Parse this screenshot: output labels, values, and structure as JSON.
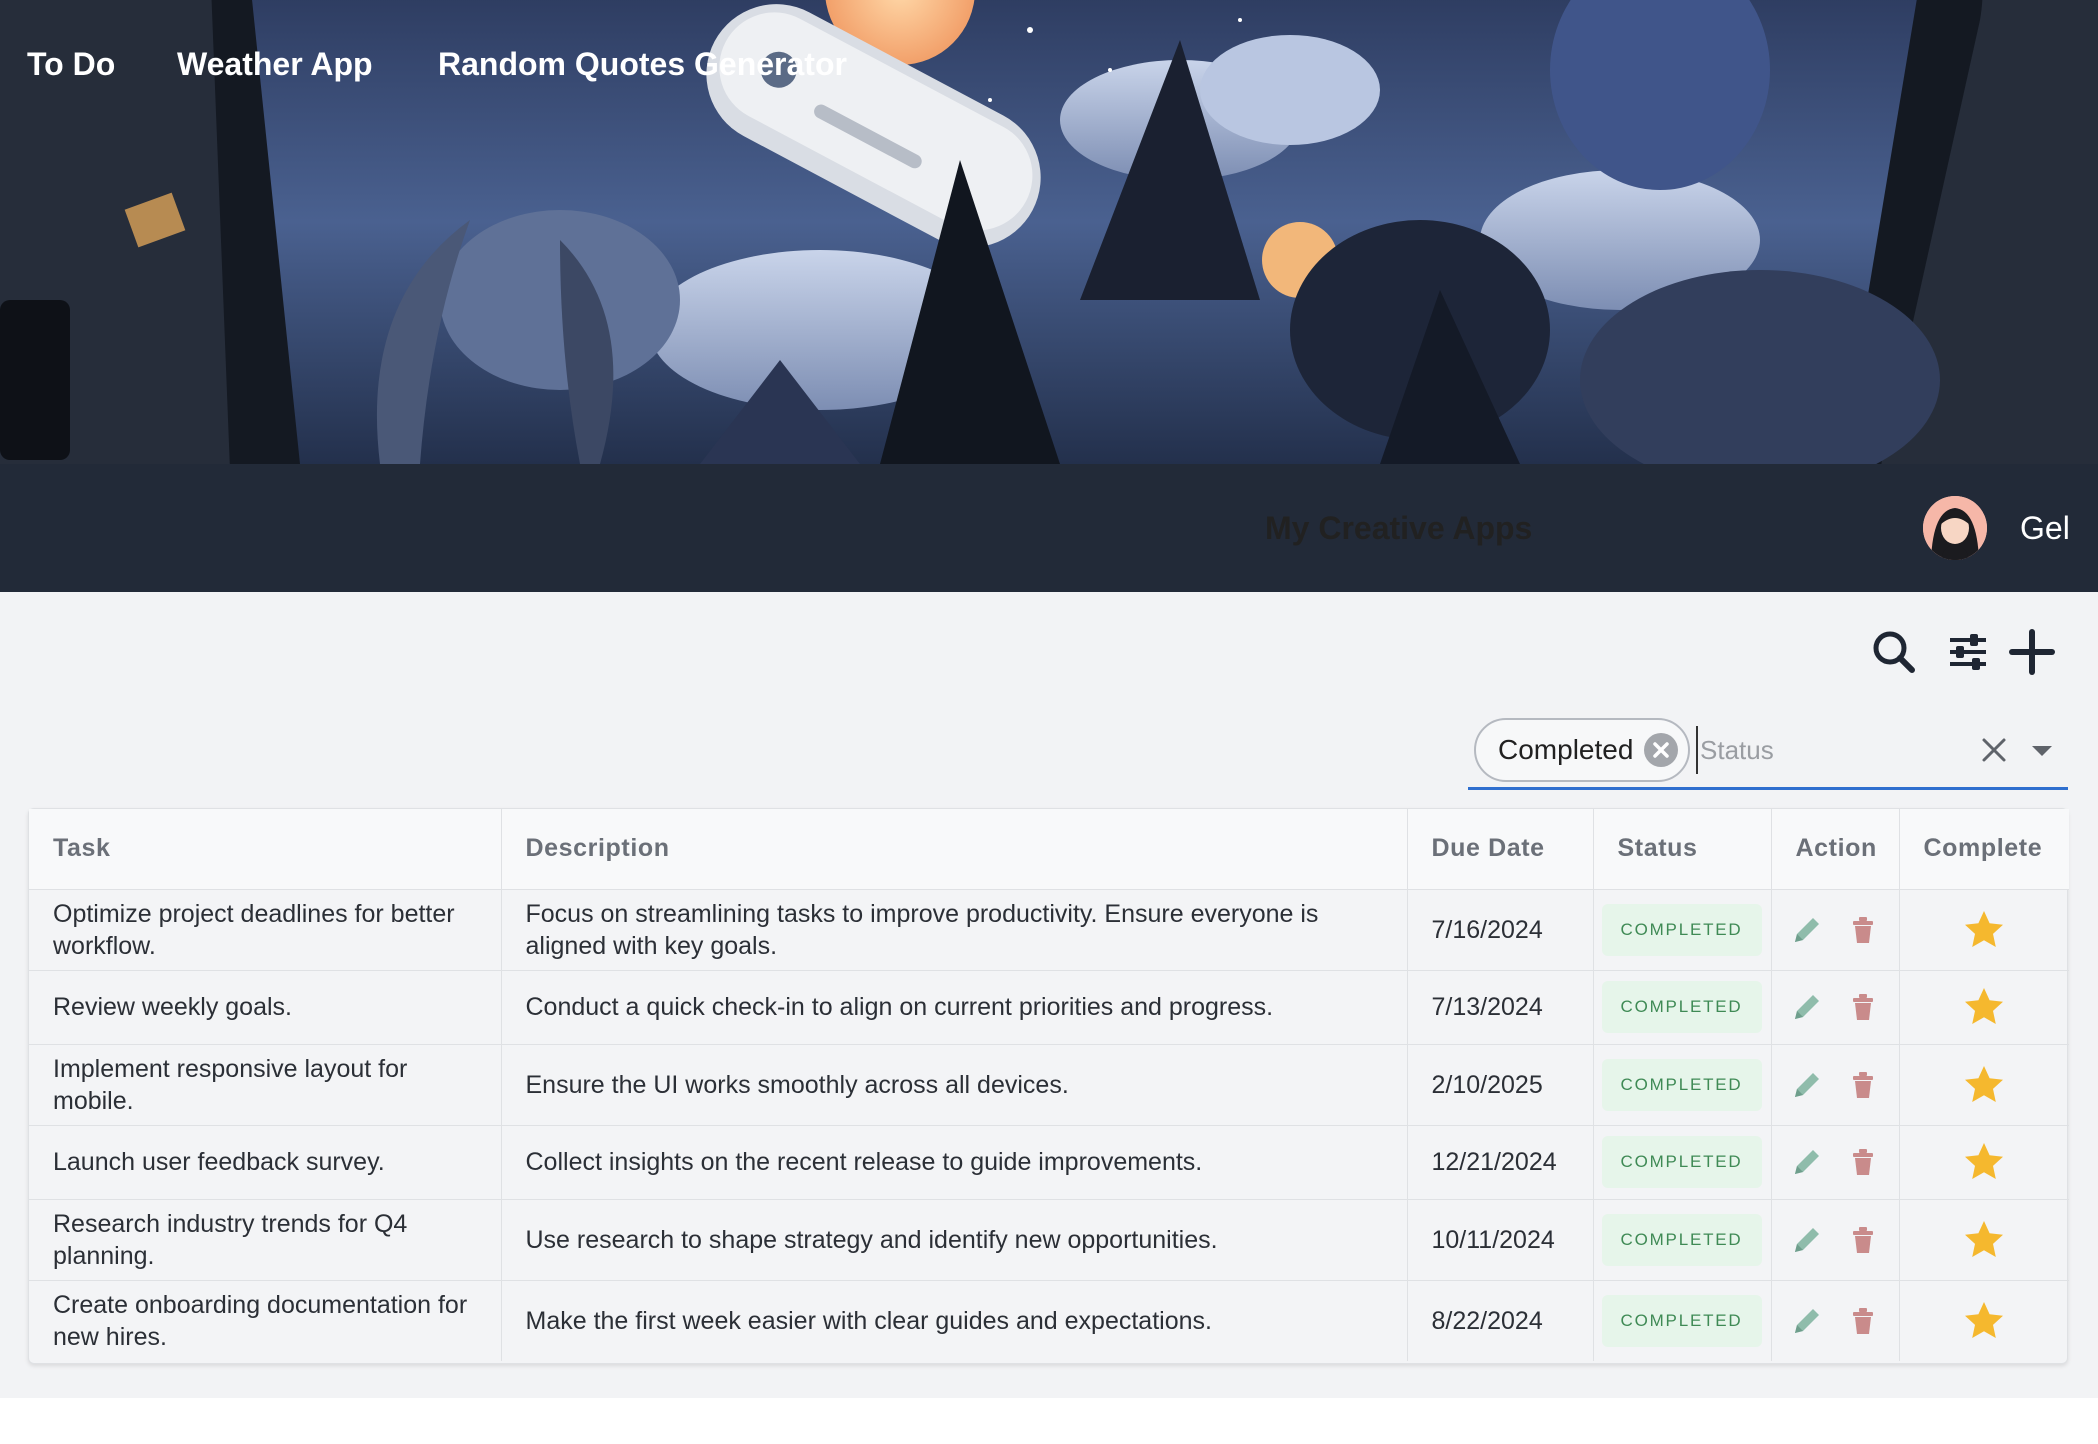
{
  "nav": {
    "links": [
      "To Do",
      "Weather App",
      "Random Quotes Generator"
    ],
    "title": "My Creative Apps",
    "user_name": "Gel"
  },
  "toolbar": {
    "icons": [
      "search-icon",
      "filter-sliders-icon",
      "plus-icon"
    ]
  },
  "filter": {
    "chip_label": "Completed",
    "placeholder": "Status"
  },
  "table": {
    "columns": [
      "Task",
      "Description",
      "Due Date",
      "Status",
      "Action",
      "Complete"
    ],
    "rows": [
      {
        "task": "Optimize project deadlines for better workflow.",
        "description": "Focus on streamlining tasks to improve productivity. Ensure everyone is aligned with key goals.",
        "due": "7/16/2024",
        "status": "COMPLETED"
      },
      {
        "task": "Review weekly goals.",
        "description": "Conduct a quick check-in to align on current priorities and progress.",
        "due": "7/13/2024",
        "status": "COMPLETED"
      },
      {
        "task": "Implement responsive layout for mobile.",
        "description": "Ensure the UI works smoothly across all devices.",
        "due": "2/10/2025",
        "status": "COMPLETED"
      },
      {
        "task": "Launch user feedback survey.",
        "description": "Collect insights on the recent release to guide improvements.",
        "due": "12/21/2024",
        "status": "COMPLETED"
      },
      {
        "task": "Research industry trends for Q4 planning.",
        "description": "Use research to shape strategy and identify new opportunities.",
        "due": "10/11/2024",
        "status": "COMPLETED"
      },
      {
        "task": "Create onboarding documentation for new hires.",
        "description": "Make the first week easier with clear guides and expectations.",
        "due": "8/22/2024",
        "status": "COMPLETED"
      }
    ]
  },
  "colors": {
    "nav_bg": "#222a38",
    "content_bg": "#f2f3f5",
    "badge_bg": "#e6f5ea",
    "badge_text": "#3f8a55",
    "edit_icon": "#8fbcab",
    "delete_icon": "#c98b8b",
    "star": "#f5b82e",
    "accent": "#2f6fcf"
  }
}
